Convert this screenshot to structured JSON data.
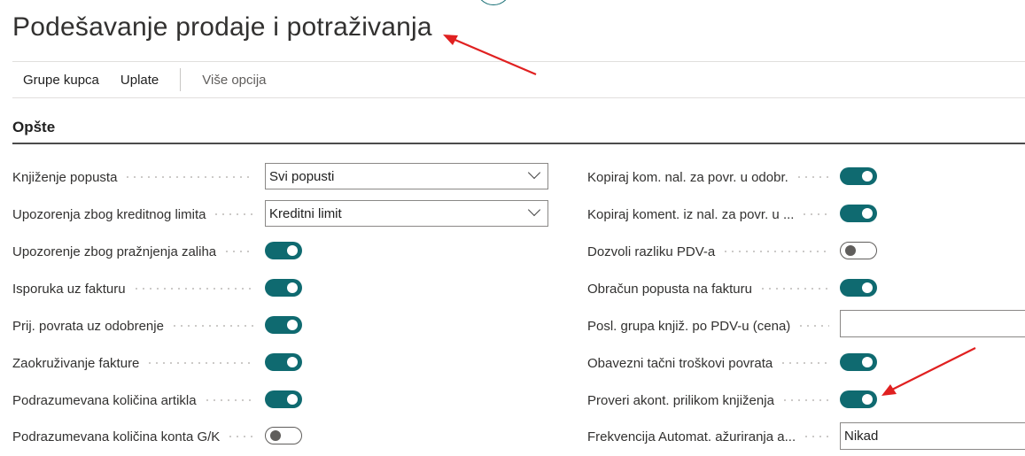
{
  "page": {
    "title": "Podešavanje prodaje i potraživanja"
  },
  "actions": [
    {
      "label": "Grupe kupca"
    },
    {
      "label": "Uplate"
    },
    {
      "label": "Više opcija"
    }
  ],
  "section": {
    "title": "Opšte"
  },
  "left_fields": [
    {
      "label": "Knjiženje popusta",
      "type": "select",
      "value": "Svi popusti"
    },
    {
      "label": "Upozorenja zbog kreditnog limita",
      "type": "select",
      "value": "Kreditni limit"
    },
    {
      "label": "Upozorenje zbog pražnjenja zaliha",
      "type": "toggle",
      "on": true
    },
    {
      "label": "Isporuka uz fakturu",
      "type": "toggle",
      "on": true
    },
    {
      "label": "Prij. povrata uz odobrenje",
      "type": "toggle",
      "on": true
    },
    {
      "label": "Zaokruživanje fakture",
      "type": "toggle",
      "on": true
    },
    {
      "label": "Podrazumevana količina artikla",
      "type": "toggle",
      "on": true
    },
    {
      "label": "Podrazumevana količina konta G/K",
      "type": "toggle",
      "on": false
    }
  ],
  "right_fields": [
    {
      "label": "Kopiraj kom. nal. za povr. u odobr.",
      "type": "toggle",
      "on": true
    },
    {
      "label": "Kopiraj koment. iz nal. za povr. u ...",
      "type": "toggle",
      "on": true
    },
    {
      "label": "Dozvoli razliku PDV-a",
      "type": "toggle",
      "on": false
    },
    {
      "label": "Obračun popusta na fakturu",
      "type": "toggle",
      "on": true
    },
    {
      "label": "Posl. grupa knjiž. po PDV-u (cena)",
      "type": "text",
      "value": ""
    },
    {
      "label": "Obavezni tačni troškovi povrata",
      "type": "toggle",
      "on": true
    },
    {
      "label": "Proveri akont. prilikom knjiženja",
      "type": "toggle",
      "on": true
    },
    {
      "label": "Frekvencija Automat. ažuriranja a...",
      "type": "text",
      "value": "Nikad"
    }
  ],
  "colors": {
    "accent": "#0f6a70",
    "annotation_arrow": "#e02020"
  }
}
